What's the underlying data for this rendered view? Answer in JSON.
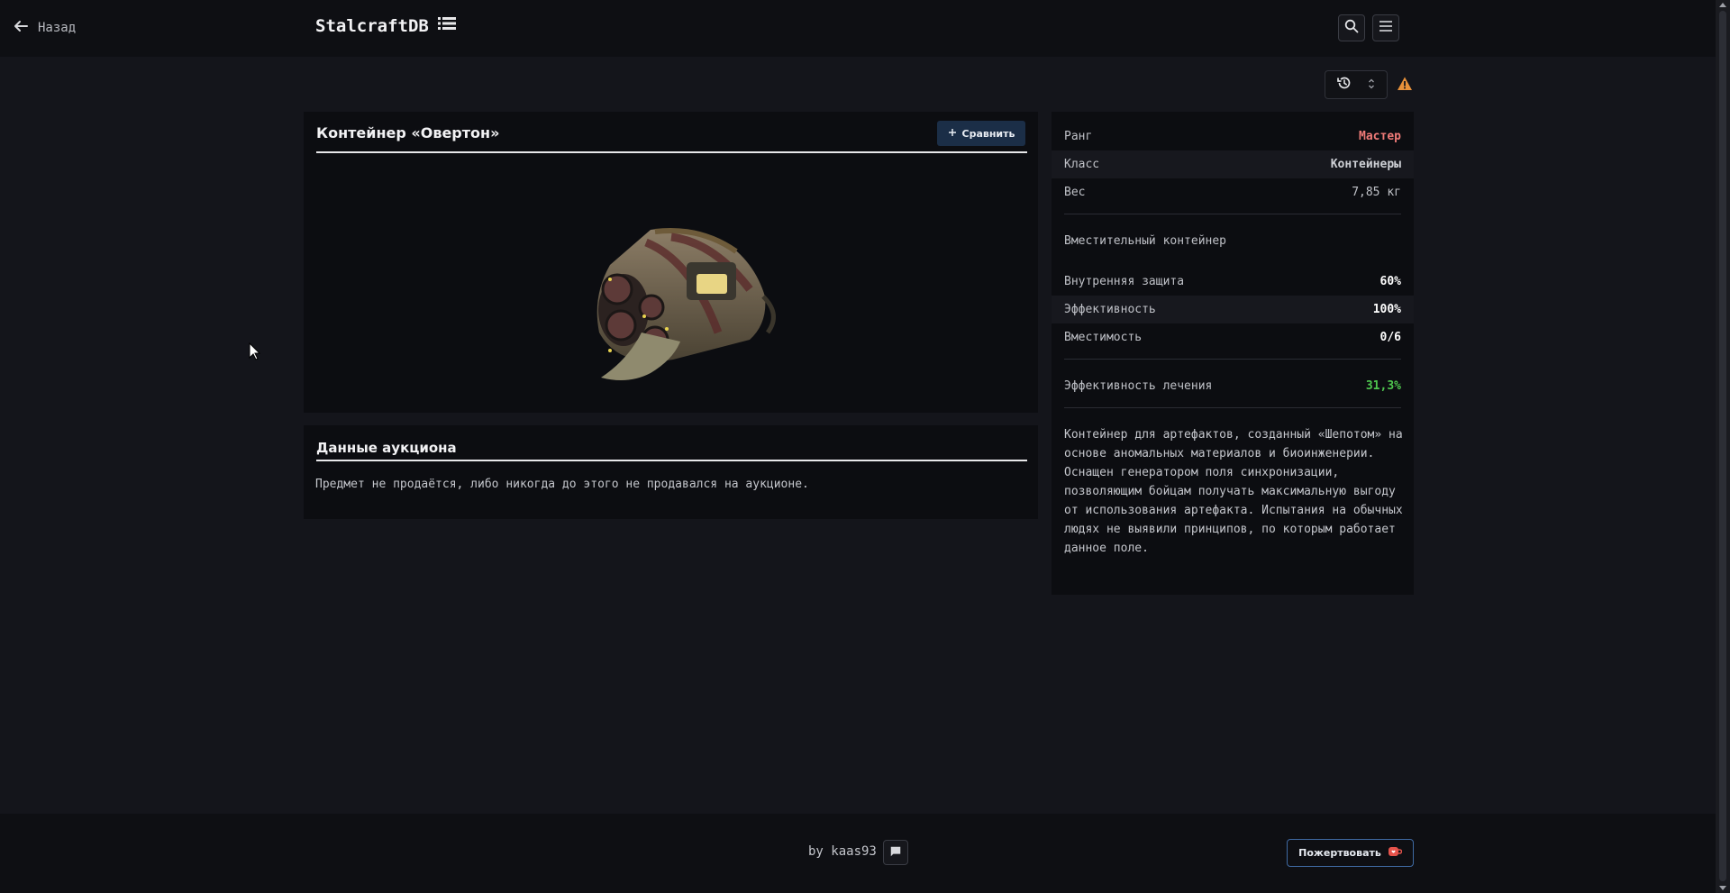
{
  "header": {
    "back_label": "Назад",
    "brand": "StalcraftDB"
  },
  "item": {
    "title": "Контейнер «Овертон»",
    "compare_label": "Сравнить"
  },
  "auction": {
    "title": "Данные аукциона",
    "text": "Предмет не продаётся, либо никогда до этого не продавался на аукционе."
  },
  "stats": {
    "rank_label": "Ранг",
    "rank_value": "Мастер",
    "class_label": "Класс",
    "class_value": "Контейнеры",
    "weight_label": "Вес",
    "weight_value": "7,85 кг",
    "subtitle": "Вместительный контейнер",
    "protection_label": "Внутренняя защита",
    "protection_value": "60%",
    "efficiency_label": "Эффективность",
    "efficiency_value": "100%",
    "capacity_label": "Вместимость",
    "capacity_value": "0/6",
    "heal_label": "Эффективность лечения",
    "heal_value": "31,3%",
    "description": "Контейнер для артефактов, созданный «Шепотом» на основе аномальных материалов и биоинженерии. Оснащен генератором поля синхронизации, позволяющим бойцам получать максимальную выгоду от использования артефакта. Испытания на обычных людях не выявили принципов, по которым работает данное поле."
  },
  "footer": {
    "by": "by kaas93",
    "donate_label": "Пожертвовать"
  },
  "colors": {
    "rank": "#f07b78",
    "heal": "#4fc74f",
    "warning": "#e8913a"
  }
}
